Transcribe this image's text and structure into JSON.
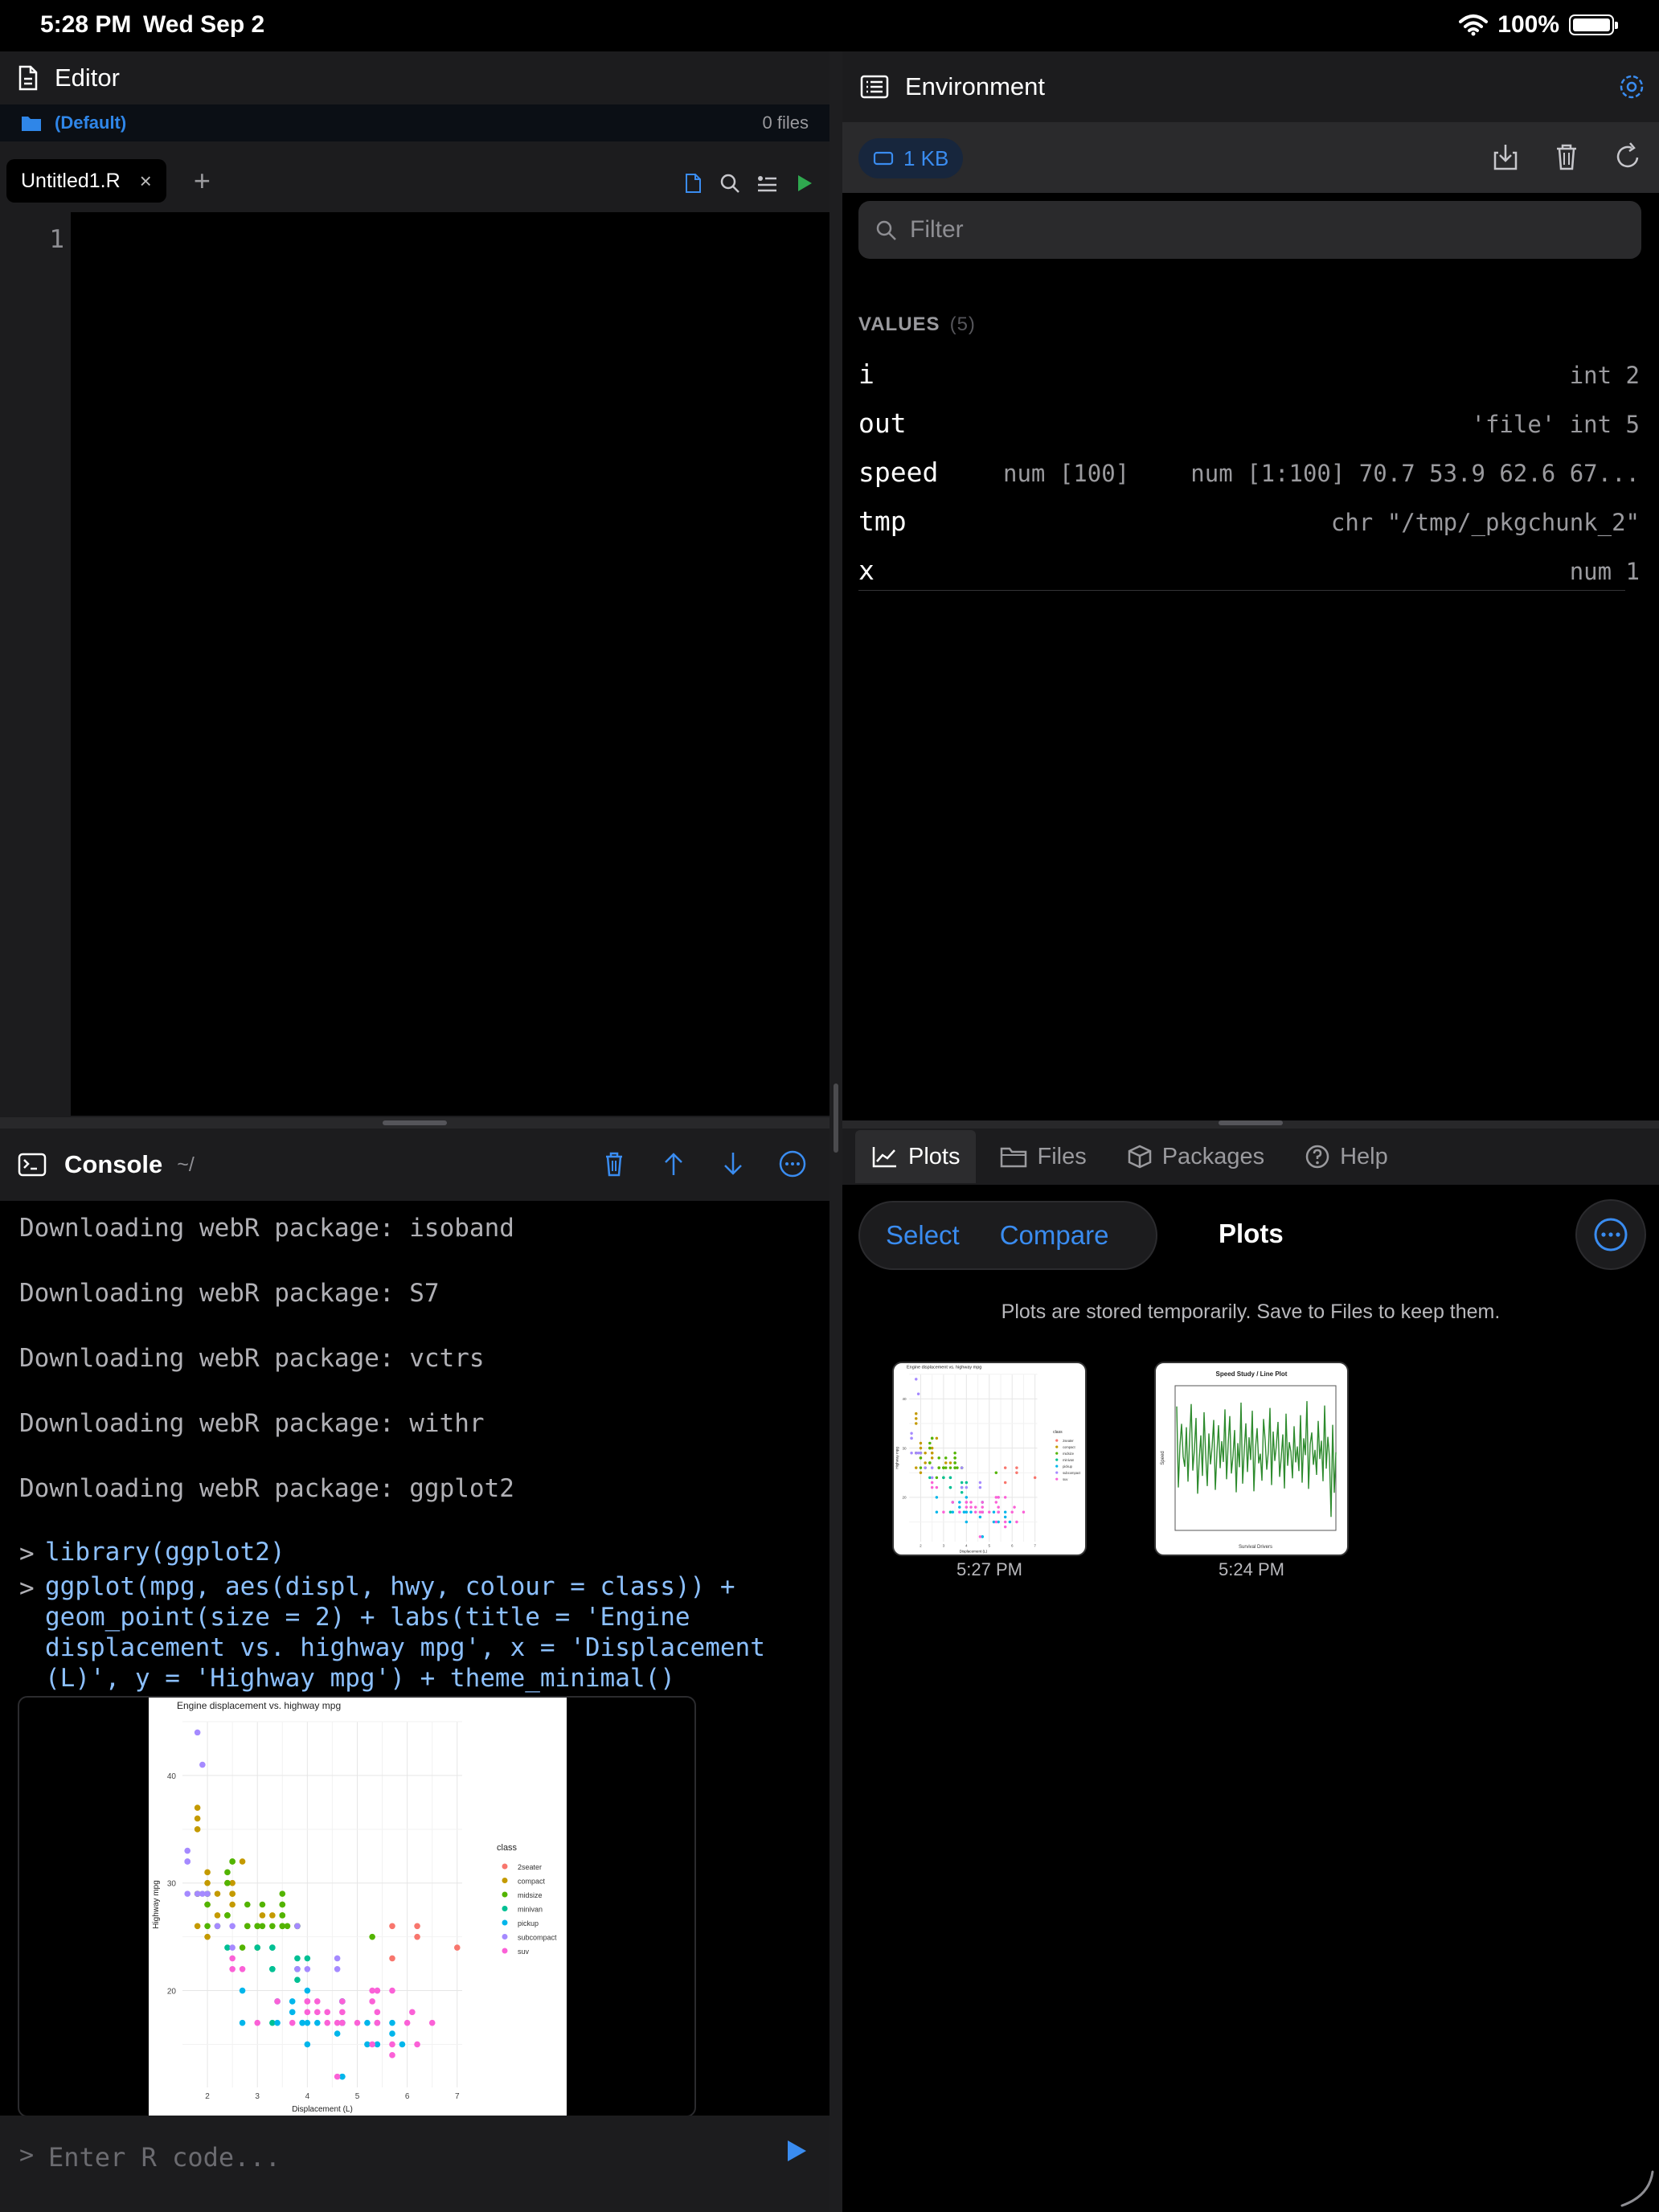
{
  "status_bar": {
    "time": "5:28 PM",
    "date": "Wed Sep 2",
    "battery": "100%"
  },
  "editor": {
    "title": "Editor",
    "project": "(Default)",
    "files_count": "0 files",
    "tab_name": "Untitled1.R",
    "tab_close": "×",
    "add_tab": "+",
    "line_number": "1"
  },
  "console": {
    "title": "Console",
    "path": "~/",
    "log_lines": [
      "Downloading webR package: isoband",
      "Downloading webR package: S7",
      "Downloading webR package: vctrs",
      "Downloading webR package: withr",
      "Downloading webR package: ggplot2"
    ],
    "prompt": ">",
    "commands": [
      [
        "library(ggplot2)"
      ],
      [
        "ggplot(mpg, aes(displ, hwy, colour = class)) +",
        "geom_point(size = 2) + labs(title = 'Engine",
        "displacement vs. highway mpg', x = 'Displacement",
        "(L)', y = 'Highway mpg') + theme_minimal()"
      ]
    ],
    "input_placeholder": "Enter R code..."
  },
  "environment": {
    "title": "Environment",
    "memory": "1  KB",
    "filter_placeholder": "Filter",
    "values_heading": "VALUES",
    "values_count": "(5)",
    "rows": [
      {
        "name": "i",
        "type": "",
        "value": "int 2"
      },
      {
        "name": "out",
        "type": "",
        "value": "'file' int 5"
      },
      {
        "name": "speed",
        "type": "num [100]",
        "value": "num [1:100] 70.7 53.9 62.6 67..."
      },
      {
        "name": "tmp",
        "type": "",
        "value": "chr \"/tmp/_pkgchunk_2\""
      },
      {
        "name": "x",
        "type": "",
        "value": "num 1"
      }
    ]
  },
  "plots_pane": {
    "tabs": [
      "Plots",
      "Files",
      "Packages",
      "Help"
    ],
    "select": "Select",
    "compare": "Compare",
    "title": "Plots",
    "note": "Plots are stored temporarily. Save to Files to keep them.",
    "thumbnails": [
      {
        "time": "5:27 PM",
        "title": "Engine displacement vs. highway mpg"
      },
      {
        "time": "5:24 PM",
        "title": "Speed Study / Line Plot"
      }
    ]
  },
  "colors": {
    "accent": "#3a8cf0",
    "run_green": "#2fa84f",
    "panel": "#1c1c1e",
    "console_command": "#8cc0ff"
  },
  "chart_data": [
    {
      "type": "scatter",
      "title": "Engine displacement vs. highway mpg",
      "xlabel": "Displacement (L)",
      "ylabel": "Highway mpg",
      "xlim": [
        1.5,
        7.1
      ],
      "ylim": [
        11,
        45
      ],
      "xticks": [
        "2",
        "3",
        "4",
        "5",
        "6",
        "7"
      ],
      "yticks": [
        "20",
        "30",
        "40"
      ],
      "legend_title": "class",
      "legend_placement": "right",
      "grid": true,
      "series": [
        {
          "name": "2seater",
          "color": "#F8766D",
          "points": [
            [
              5.7,
              26
            ],
            [
              5.7,
              23
            ],
            [
              6.2,
              26
            ],
            [
              6.2,
              25
            ],
            [
              7.0,
              24
            ]
          ]
        },
        {
          "name": "compact",
          "color": "#C49A00",
          "points": [
            [
              1.8,
              29
            ],
            [
              1.8,
              29
            ],
            [
              2.0,
              31
            ],
            [
              2.0,
              30
            ],
            [
              2.8,
              26
            ],
            [
              2.8,
              26
            ],
            [
              3.1,
              27
            ],
            [
              1.8,
              26
            ],
            [
              2.0,
              25
            ],
            [
              2.0,
              28
            ],
            [
              2.2,
              27
            ],
            [
              2.2,
              29
            ],
            [
              2.4,
              27
            ],
            [
              2.4,
              30
            ],
            [
              2.4,
              30
            ],
            [
              3.0,
              26
            ],
            [
              1.8,
              36
            ],
            [
              1.8,
              37
            ],
            [
              1.8,
              35
            ],
            [
              2.5,
              29
            ],
            [
              2.5,
              28
            ],
            [
              2.5,
              30
            ],
            [
              2.5,
              29
            ],
            [
              3.3,
              27
            ],
            [
              2.7,
              32
            ]
          ]
        },
        {
          "name": "midsize",
          "color": "#53B400",
          "points": [
            [
              2.4,
              27
            ],
            [
              2.4,
              30
            ],
            [
              3.1,
              26
            ],
            [
              3.5,
              29
            ],
            [
              3.6,
              26
            ],
            [
              2.4,
              31
            ],
            [
              3.0,
              26
            ],
            [
              3.3,
              26
            ],
            [
              3.5,
              28
            ],
            [
              2.5,
              32
            ],
            [
              2.5,
              32
            ],
            [
              3.0,
              24
            ],
            [
              3.0,
              26
            ],
            [
              3.5,
              26
            ],
            [
              2.2,
              26
            ],
            [
              2.4,
              27
            ],
            [
              2.7,
              24
            ],
            [
              3.5,
              27
            ],
            [
              3.5,
              26
            ],
            [
              3.8,
              26
            ],
            [
              3.8,
              26
            ],
            [
              3.8,
              26
            ],
            [
              5.3,
              25
            ],
            [
              2.8,
              26
            ],
            [
              3.1,
              28
            ],
            [
              3.5,
              28
            ],
            [
              3.5,
              27
            ],
            [
              2.0,
              29
            ],
            [
              2.0,
              26
            ],
            [
              2.0,
              28
            ],
            [
              2.8,
              28
            ],
            [
              1.8,
              29
            ],
            [
              2.0,
              29
            ]
          ]
        },
        {
          "name": "minivan",
          "color": "#00C094",
          "points": [
            [
              2.4,
              24
            ],
            [
              3.0,
              24
            ],
            [
              3.3,
              22
            ],
            [
              3.3,
              22
            ],
            [
              3.3,
              24
            ],
            [
              3.3,
              24
            ],
            [
              3.3,
              17
            ],
            [
              3.8,
              22
            ],
            [
              3.8,
              21
            ],
            [
              3.8,
              23
            ],
            [
              4.0,
              23
            ]
          ]
        },
        {
          "name": "pickup",
          "color": "#00B6EB",
          "points": [
            [
              3.7,
              19
            ],
            [
              3.7,
              18
            ],
            [
              3.9,
              17
            ],
            [
              3.9,
              17
            ],
            [
              4.7,
              19
            ],
            [
              4.7,
              19
            ],
            [
              4.7,
              17
            ],
            [
              5.2,
              17
            ],
            [
              5.2,
              15
            ],
            [
              4.7,
              12
            ],
            [
              4.7,
              17
            ],
            [
              4.7,
              17
            ],
            [
              4.7,
              12
            ],
            [
              5.7,
              17
            ],
            [
              5.9,
              15
            ],
            [
              2.7,
              20
            ],
            [
              2.7,
              17
            ],
            [
              3.4,
              19
            ],
            [
              3.4,
              17
            ],
            [
              4.0,
              17
            ],
            [
              4.7,
              17
            ],
            [
              4.6,
              16
            ],
            [
              5.4,
              17
            ],
            [
              5.4,
              15
            ],
            [
              4.0,
              15
            ],
            [
              4.2,
              17
            ],
            [
              4.0,
              20
            ],
            [
              5.7,
              16
            ]
          ]
        },
        {
          "name": "subcompact",
          "color": "#A58AFF",
          "points": [
            [
              1.8,
              29
            ],
            [
              1.8,
              44
            ],
            [
              1.6,
              33
            ],
            [
              1.6,
              32
            ],
            [
              1.6,
              32
            ],
            [
              1.6,
              29
            ],
            [
              2.0,
              29
            ],
            [
              1.9,
              29
            ],
            [
              2.5,
              26
            ],
            [
              2.5,
              24
            ],
            [
              3.8,
              26
            ],
            [
              4.6,
              23
            ],
            [
              4.6,
              22
            ],
            [
              5.4,
              20
            ],
            [
              4.0,
              22
            ],
            [
              3.8,
              22
            ],
            [
              2.2,
              26
            ],
            [
              1.9,
              41
            ]
          ]
        },
        {
          "name": "suv",
          "color": "#FB61D7",
          "points": [
            [
              5.7,
              20
            ],
            [
              6.5,
              17
            ],
            [
              4.2,
              19
            ],
            [
              4.4,
              17
            ],
            [
              5.3,
              20
            ],
            [
              5.3,
              15
            ],
            [
              5.7,
              15
            ],
            [
              6.0,
              17
            ],
            [
              5.0,
              17
            ],
            [
              4.7,
              17
            ],
            [
              5.7,
              14
            ],
            [
              6.1,
              18
            ],
            [
              5.4,
              20
            ],
            [
              5.4,
              17
            ],
            [
              4.0,
              19
            ],
            [
              4.6,
              12
            ],
            [
              3.0,
              17
            ],
            [
              3.7,
              17
            ],
            [
              4.7,
              17
            ],
            [
              2.5,
              23
            ],
            [
              2.5,
              22
            ],
            [
              4.2,
              18
            ],
            [
              4.4,
              18
            ],
            [
              2.7,
              22
            ],
            [
              3.4,
              19
            ],
            [
              4.0,
              19
            ],
            [
              4.7,
              19
            ],
            [
              4.0,
              18
            ],
            [
              4.6,
              17
            ],
            [
              5.4,
              18
            ],
            [
              5.4,
              17
            ],
            [
              5.3,
              19
            ],
            [
              6.2,
              15
            ],
            [
              4.7,
              18
            ]
          ]
        }
      ]
    },
    {
      "type": "line",
      "title": "Speed Study / Line Plot",
      "xlabel": "Survival Drivers",
      "ylabel": "Speed",
      "xlim": [
        0,
        100
      ],
      "ylim": [
        45,
        75
      ],
      "color": "#2e8b2e",
      "series": [
        {
          "values": [
            70.7,
            53.9,
            62.6,
            67.1,
            60.3,
            58.2,
            66.4,
            55.1,
            63.9,
            71.2,
            57.4,
            61.8,
            68.3,
            52.6,
            59.9,
            64.7,
            56.3,
            69.5,
            60.8,
            54.2,
            65.1,
            58.7,
            62.3,
            67.9,
            53.4,
            61.1,
            66.8,
            57.9,
            63.5,
            59.2,
            70.1,
            55.6,
            62.9,
            68.7,
            56.8,
            60.4,
            65.8,
            52.9,
            63.1,
            58.1,
            71.5,
            54.7,
            61.6,
            67.2,
            57.1,
            64.3,
            59.6,
            69.8,
            53.1,
            62.1,
            66.2,
            58.9,
            60.9,
            55.3,
            68.1,
            63.7,
            57.6,
            61.4,
            70.4,
            54.4,
            65.5,
            59.4,
            62.7,
            67.5,
            56.1,
            60.1,
            64.9,
            53.7,
            69.2,
            58.4,
            63.3,
            61.3,
            55.8,
            66.6,
            59.1,
            62.4,
            57.3,
            68.9,
            54.9,
            64.1,
            60.6,
            71.8,
            53.6,
            62.8,
            65.3,
            58.6,
            61.7,
            56.5,
            67.7,
            59.8,
            63.6,
            55.2,
            70.9,
            57.8,
            64.4,
            60.2,
            47.8,
            66.9,
            52.8,
            61.2
          ]
        }
      ]
    }
  ]
}
